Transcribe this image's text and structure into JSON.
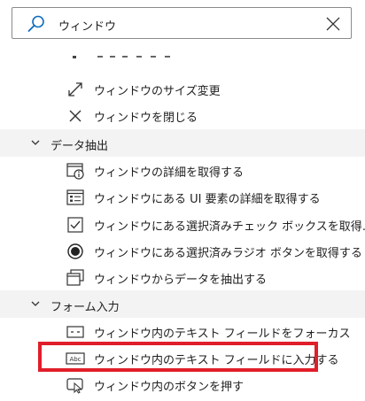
{
  "search": {
    "query": "ウィンドウ"
  },
  "items": {
    "resize": "ウィンドウのサイズ変更",
    "close": "ウィンドウを閉じる",
    "get_details": "ウィンドウの詳細を取得する",
    "ui_element_details": "ウィンドウにある UI 要素の詳細を取得する",
    "checkbox": "ウィンドウにある選択済みチェック ボックスを取得…",
    "radio": "ウィンドウにある選択済みラジオ ボタンを取得する",
    "extract": "ウィンドウからデータを抽出する",
    "focus_textfield": "ウィンドウ内のテキスト フィールドをフォーカス",
    "fill_textfield": "ウィンドウ内のテキスト フィールドに入力する",
    "press_button": "ウィンドウ内のボタンを押す"
  },
  "categories": {
    "data_extraction": "データ抽出",
    "form_fill": "フォーム入力"
  },
  "icons": {
    "search": "search-icon",
    "clear": "close-icon",
    "resize": "diagonal-arrows-icon",
    "close": "x-icon",
    "details": "window-info-icon",
    "ui_element": "list-form-icon",
    "checkbox": "checkbox-icon",
    "radio": "radio-icon",
    "extract": "window-stack-icon",
    "textfield": "textfield-icon",
    "abc": "abc-textfield-icon",
    "button": "pointer-button-icon"
  },
  "colors": {
    "accent": "#0f6cbd",
    "highlight_border": "#e01e2a",
    "category_bg": "#f3f3f3"
  }
}
